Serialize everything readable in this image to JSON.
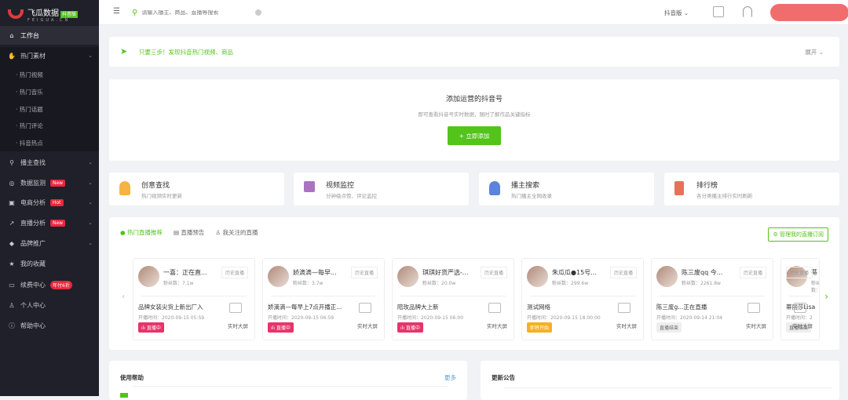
{
  "sidebar": {
    "logo": {
      "name": "飞瓜数据",
      "badge": "抖音版",
      "sub": "FEIGUA.CN"
    },
    "items": [
      {
        "label": "工作台",
        "icon": "home-icon"
      },
      {
        "label": "热门素材",
        "icon": "hand-icon"
      },
      {
        "label": "播主查找",
        "icon": "search-icon"
      },
      {
        "label": "数据监测",
        "icon": "monitor-icon",
        "tag": "New"
      },
      {
        "label": "电商分析",
        "icon": "bag-icon",
        "tag": "Hot"
      },
      {
        "label": "直播分析",
        "icon": "trend-icon",
        "tag": "New"
      },
      {
        "label": "品牌推广",
        "icon": "diamond-icon"
      },
      {
        "label": "我的收藏",
        "icon": "star-icon"
      },
      {
        "label": "续费中心",
        "icon": "card-icon",
        "tag": "年付6折"
      },
      {
        "label": "个人中心",
        "icon": "user-icon"
      },
      {
        "label": "帮助中心",
        "icon": "help-icon"
      }
    ],
    "sub_items": [
      "热门视频",
      "热门音乐",
      "热门话题",
      "热门评论",
      "抖音热点"
    ]
  },
  "topbar": {
    "search_placeholder": "请输入播主、商品、直播等搜索",
    "version": "抖音版"
  },
  "banner": {
    "text": "只要三步！发现抖音热门视频、商品",
    "expand": "展开"
  },
  "add": {
    "title": "添加运营的抖音号",
    "desc": "即可查看抖音号实时数据，随时了解作品关键指标",
    "button": "+ 立即添加"
  },
  "features": [
    {
      "title": "创意查找",
      "desc": "热门视频实时更新",
      "color": "#f5a623"
    },
    {
      "title": "视频监控",
      "desc": "分钟级点赞、评论监控",
      "color": "#9b59b6"
    },
    {
      "title": "播主搜索",
      "desc": "热门播主全网收录",
      "color": "#3f6fd8"
    },
    {
      "title": "排行榜",
      "desc": "各分类播主排行实时刷新",
      "color": "#e05a3a"
    }
  ],
  "live": {
    "tabs": [
      "热门直播推荐",
      "直播预告",
      "我关注的直播"
    ],
    "manage": "管理我的直播订阅",
    "fans_label": "粉丝数：",
    "time_label": "开播时间：",
    "history": "历史直播",
    "screen": "实时大屏",
    "cards": [
      {
        "name": "一喜：正在直...",
        "fans": "7.1w",
        "title": "品牌女装尖货上新出厂入",
        "time": "2020-09-15 05:59",
        "status": "直播中",
        "status_color": "#e8336a"
      },
      {
        "name": "娇滴滴—每早...",
        "fans": "3.7w",
        "title": "娇滴滴—每早上7点开播正...",
        "time": "2020-09-15 06:59",
        "status": "直播中",
        "status_color": "#e8336a"
      },
      {
        "name": "琪琪好货严选-...",
        "fans": "20.0w",
        "title": "陪玫品牌大上新",
        "time": "2020-09-15 06:00",
        "status": "直播中",
        "status_color": "#e8336a"
      },
      {
        "name": "朱瓜瓜●15号...",
        "fans": "299.6w",
        "title": "测试网络",
        "time": "2020-09-15 18:00:00",
        "status": "即将开始",
        "status_color": "#f5b120"
      },
      {
        "name": "陈三废qq 今...",
        "fans": "2261.8w",
        "title": "陈三废g...正在直播",
        "time": "2020-09-14 21:04",
        "status": "直播结束",
        "status_color": "#eeeeee"
      },
      {
        "name": "蒂",
        "fans": "",
        "title": "蒂丽莎Lisa",
        "time": "2",
        "status": "直播结束",
        "status_color": "#eeeeee"
      }
    ]
  },
  "help": {
    "title": "使用帮助",
    "more": "更多"
  },
  "notice": {
    "title": "更新公告"
  }
}
